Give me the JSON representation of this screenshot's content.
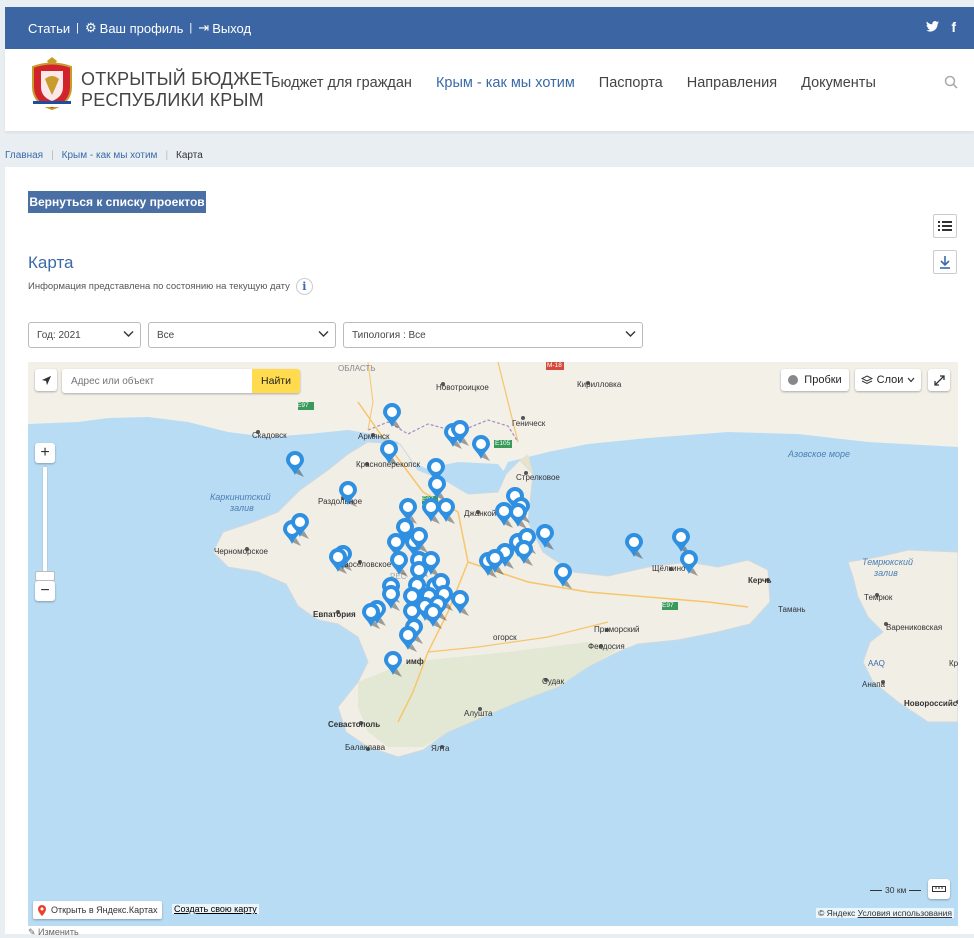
{
  "topbar": {
    "links": [
      "Статьи",
      "Ваш профиль",
      "Выход"
    ]
  },
  "brand": {
    "line1": "ОТКРЫТЫЙ БЮДЖЕТ",
    "line2": "РЕСПУБЛИКИ КРЫМ"
  },
  "nav": {
    "items": [
      "Бюджет для граждан",
      "Крым - как мы хотим",
      "Паспорта",
      "Направления",
      "Документы"
    ],
    "active_index": 1
  },
  "breadcrumbs": {
    "home": "Главная",
    "section": "Крым - как мы хотим",
    "current": "Карта"
  },
  "page": {
    "back_button": "Вернуться к списку проектов",
    "title": "Карта",
    "subtitle": "Информация представлена по состоянию на текущую дату"
  },
  "filters": {
    "year": "Год: 2021",
    "all": "Все",
    "typology": "Типология : Все"
  },
  "map": {
    "search_placeholder": "Адрес или объект",
    "search_button": "Найти",
    "traffic": "Пробки",
    "layers": "Слои",
    "open_yandex": "Открыть в Яндекс.Картах",
    "create_map": "Создать свою карту",
    "copyright": "© Яндекс",
    "terms": "Условия использования",
    "scale": "30 км",
    "labels": {
      "oblast": "ОБЛАСТЬ",
      "novotroitskoe": "Новотроицкое",
      "m18": "М-18",
      "kirillovka": "Кирилловка",
      "skadovsk": "Скадовск",
      "armyansk": "Армянск",
      "genichesk": "Геническ",
      "e105": "E105",
      "azov": "Азовское море",
      "krasnoperekopsk": "Красноперекопск",
      "strelkovoe": "Стрелковое",
      "karkinitsky1": "Каркинитский",
      "karkinitsky2": "залив",
      "razdolnoe": "Раздольное",
      "e97": "E97",
      "dzhankoy": "Джанкой",
      "chernomorskoe": "Черноморское",
      "novoselovskoe": "Новосёловское",
      "rep": "РЕС",
      "shchelkino": "Щёлкино",
      "kerch": "Керчь",
      "temryuk1": "Темрюкский",
      "temryuk2": "залив",
      "temryuk": "Темрюк",
      "taman": "Тамань",
      "evpatoria": "Евпатория",
      "primorsky": "Приморский",
      "belogorsk": "огорск",
      "feodosia": "Феодосия",
      "varenikovskaya": "Варениковская",
      "simf": "имф",
      "sudak": "Судак",
      "aaq": "AAQ",
      "anapa": "Анапа",
      "novorossiysk": "Новороссийс",
      "sevastopol": "Севастополь",
      "alushta": "Алушта",
      "balaklava": "Балаклава",
      "yalta": "Ялта",
      "kr": "Кр"
    }
  },
  "footer": {
    "change": "Изменить"
  },
  "colors": {
    "primary": "#3c66a3",
    "pin": "#2f8fe0",
    "sea": "#b9dcf5",
    "search_button": "#ffdb4d"
  }
}
